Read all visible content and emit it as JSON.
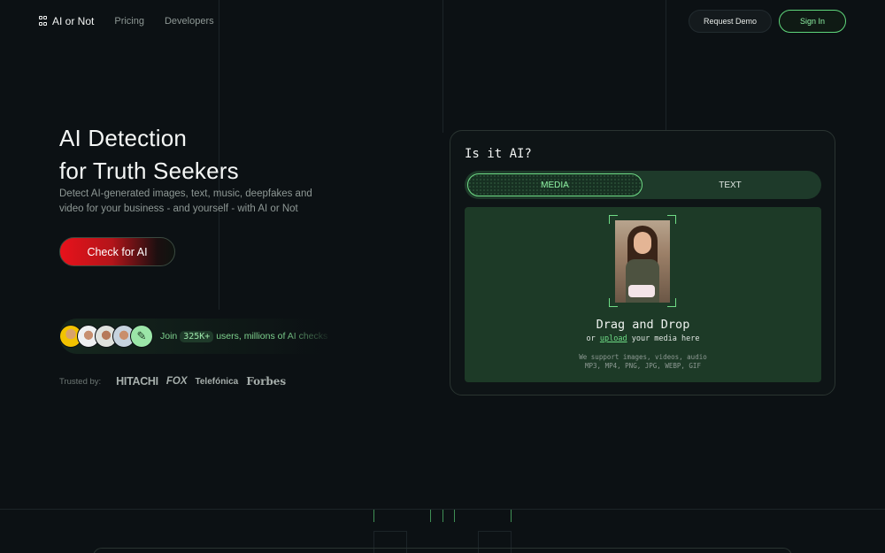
{
  "nav": {
    "brand": "AI or Not",
    "links": [
      "Pricing",
      "Developers"
    ],
    "request_demo": "Request Demo",
    "sign_in": "Sign In"
  },
  "hero": {
    "title_line1": "AI Detection",
    "title_line2": "for Truth Seekers",
    "subtitle": "Detect AI-generated images, text, music, deepfakes and video for your business - and yourself - with AI or Not",
    "cta": "Check for AI"
  },
  "social_proof": {
    "prefix": "Join",
    "count": "325K+",
    "suffix": "users, millions of AI checks"
  },
  "trusted": {
    "label": "Trusted by:",
    "brands": [
      "HITACHI",
      "FOX",
      "Telefónica",
      "Forbes"
    ]
  },
  "detector": {
    "title": "Is it AI?",
    "tabs": [
      "MEDIA",
      "TEXT"
    ],
    "active_tab": "MEDIA",
    "drop_title": "Drag and Drop",
    "drop_sub_prefix": "or",
    "drop_sub_link": "upload",
    "drop_sub_suffix": "your media here",
    "support_line1": "We support images, videos, audio",
    "support_line2": "MP3, MP4, PNG, JPG, WEBP, GIF"
  },
  "colors": {
    "background": "#0c1114",
    "accent_green": "#6fdc86",
    "cta_red": "#e8121b",
    "drop_zone": "#1d3a27"
  },
  "icons": [
    "logo-icon",
    "avatar-user-icon"
  ]
}
